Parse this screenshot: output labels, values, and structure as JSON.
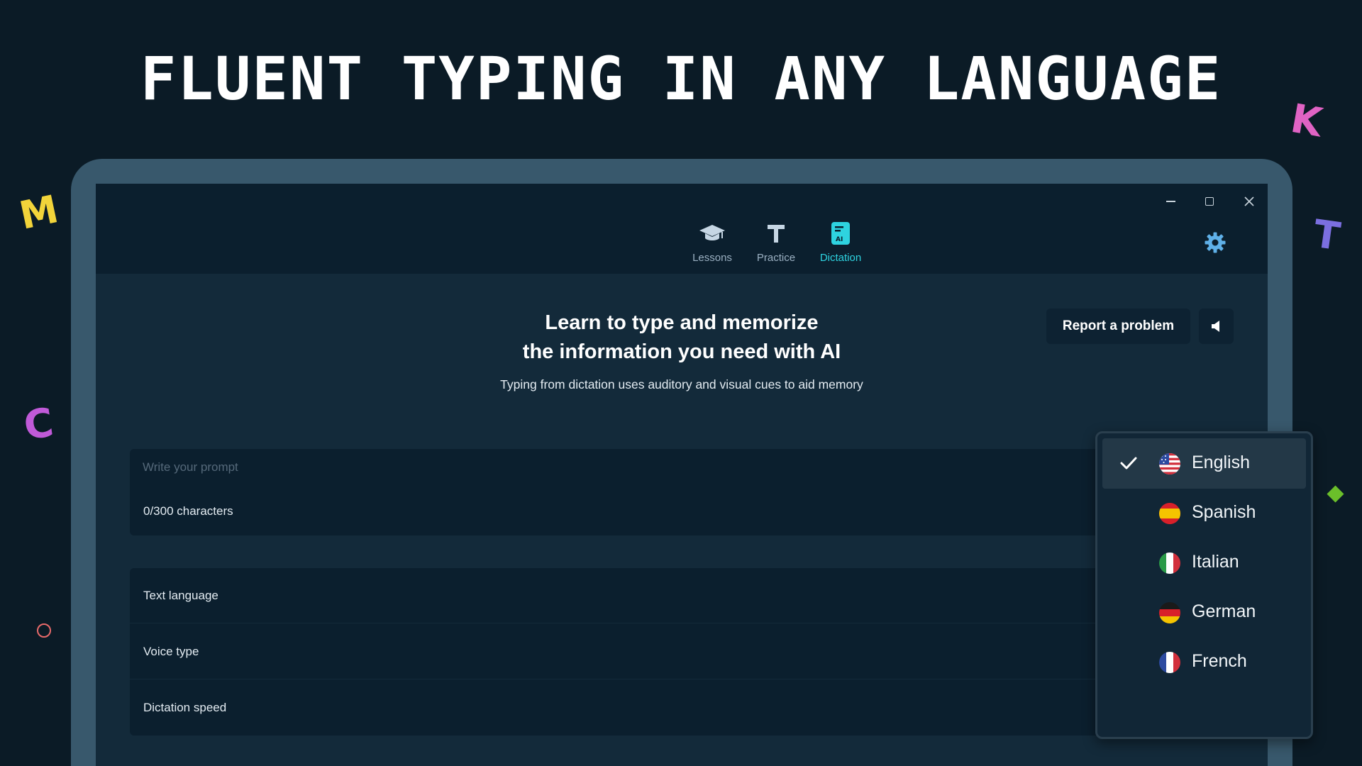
{
  "headline": "FLUENT TYPING IN ANY LANGUAGE",
  "decorations": {
    "letters": [
      "M",
      "K",
      "T",
      "C"
    ]
  },
  "nav": {
    "tabs": [
      {
        "label": "Lessons",
        "icon": "graduation-cap-icon"
      },
      {
        "label": "Practice",
        "icon": "text-t-icon"
      },
      {
        "label": "Dictation",
        "icon": "ai-document-icon",
        "active": true
      }
    ]
  },
  "hero": {
    "title_line1": "Learn to type and memorize",
    "title_line2": "the information you need with AI",
    "subtitle": "Typing from dictation uses auditory and visual cues to aid memory"
  },
  "toolbar": {
    "report_label": "Report a problem"
  },
  "prompt": {
    "placeholder": "Write your prompt",
    "value": "",
    "counter": "0/300 characters"
  },
  "settings": {
    "rows": [
      {
        "label": "Text language"
      },
      {
        "label": "Voice type"
      },
      {
        "label": "Dictation speed"
      }
    ]
  },
  "language_dropdown": {
    "selected": "English",
    "options": [
      {
        "label": "English",
        "flag": "us-flag-icon"
      },
      {
        "label": "Spanish",
        "flag": "spain-flag-icon"
      },
      {
        "label": "Italian",
        "flag": "italy-flag-icon"
      },
      {
        "label": "German",
        "flag": "germany-flag-icon"
      },
      {
        "label": "French",
        "flag": "france-flag-icon"
      }
    ]
  },
  "colors": {
    "background": "#0b1b26",
    "accent": "#2ed3e0",
    "device_frame": "#38586c",
    "selected_item": "#233847"
  }
}
